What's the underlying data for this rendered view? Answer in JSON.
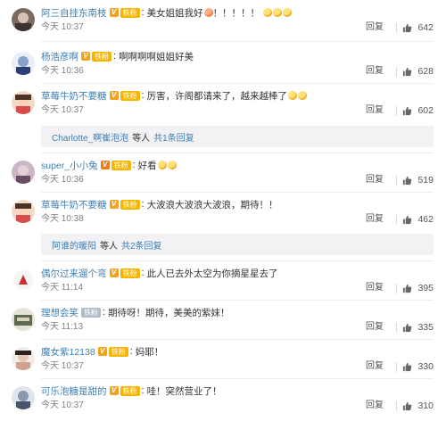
{
  "colors": {
    "link": "#3e7fb2",
    "vip": "#f3a21c",
    "fan_badge": "#f7b500",
    "muted": "#808080"
  },
  "comments": [
    {
      "username": "阿三自挂东南枝",
      "badges": [
        "vip-icon",
        "fan-badge-icon"
      ],
      "fan_label": "铁粉",
      "text": "美女姐姐我好",
      "text_tail": "！！！！！",
      "time": "今天 10:37",
      "reply_label": "回复",
      "likes": "642"
    },
    {
      "username": "杨浩彦啊",
      "badges": [
        "vip-icon",
        "fan-badge-icon"
      ],
      "fan_label": "铁粉",
      "text": "啊啊啊啊姐姐好美",
      "text_tail": "",
      "time": "今天 10:36",
      "reply_label": "回复",
      "likes": "628"
    },
    {
      "username": "草莓牛奶不要糖",
      "badges": [
        "vip-icon",
        "fan-badge-icon"
      ],
      "fan_label": "铁粉",
      "text": "厉害，许阁都请来了，越来越棒了",
      "text_tail": "",
      "time": "今天 10:37",
      "reply_label": "回复",
      "likes": "602",
      "subreply": {
        "who": "Charlotte_啊崔泡泡",
        "mid": "等人",
        "count": "共1条回复"
      }
    },
    {
      "username": "super_小小兔",
      "badges": [
        "vip-icon",
        "fan-badge-icon"
      ],
      "fan_label": "铁粉",
      "text": "好看",
      "text_tail": "",
      "time": "今天 10:36",
      "reply_label": "回复",
      "likes": "519"
    },
    {
      "username": "草莓牛奶不要糖",
      "badges": [
        "vip-icon",
        "fan-badge-icon"
      ],
      "fan_label": "铁粉",
      "text": "大波浪大波浪大波浪，期待！！",
      "text_tail": "",
      "time": "今天 10:38",
      "reply_label": "回复",
      "likes": "462",
      "subreply": {
        "who": "阿谁的暖阳",
        "mid": "等人",
        "count": "共2条回复"
      }
    },
    {
      "username": "偶尔过来遛个弯",
      "badges": [
        "vip-icon",
        "fan-badge-icon"
      ],
      "fan_label": "铁粉",
      "text": "此人已去外太空为你摘星星去了",
      "text_tail": "",
      "time": "今天 11:14",
      "reply_label": "回复",
      "likes": "395"
    },
    {
      "username": "理想会笑",
      "badges": [
        "fan-badge-grey-icon"
      ],
      "fan_label": "铁粉",
      "text": "期待呀！期待，美美的紫妹！",
      "text_tail": "",
      "time": "今天 11:13",
      "reply_label": "回复",
      "likes": "335"
    },
    {
      "username": "魔女紫12138",
      "badges": [
        "vip-icon",
        "fan-badge-icon"
      ],
      "fan_label": "铁粉",
      "text": "妈耶！",
      "text_tail": "",
      "time": "今天 10:37",
      "reply_label": "回复",
      "likes": "330"
    },
    {
      "username": "可乐泡糖是甜的",
      "badges": [
        "vip-icon",
        "fan-badge-icon"
      ],
      "fan_label": "铁粉",
      "text": "哇！突然营业了！",
      "text_tail": "",
      "time": "今天 10:37",
      "reply_label": "回复",
      "likes": "310"
    }
  ]
}
